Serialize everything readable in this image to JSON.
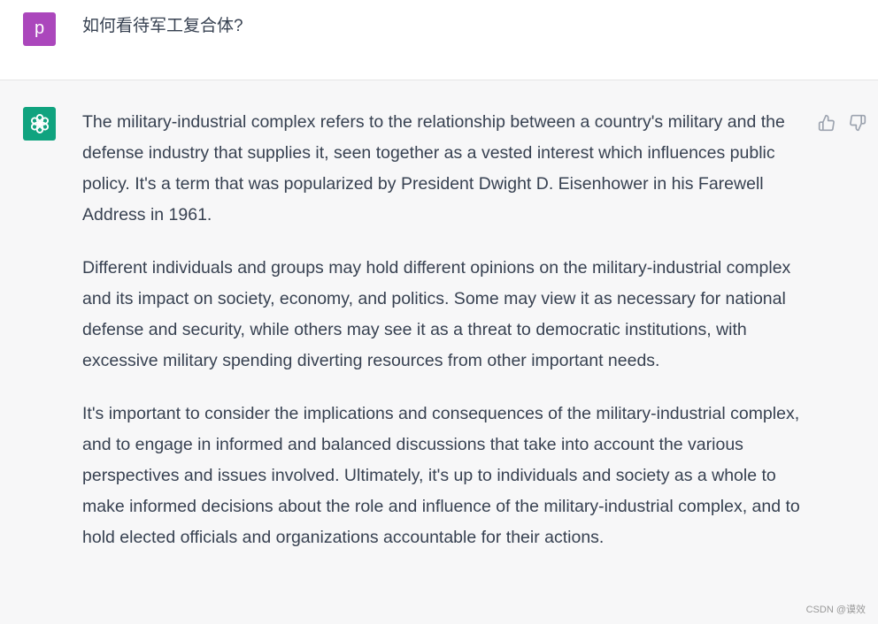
{
  "user": {
    "avatar_letter": "p",
    "avatar_color": "#ab47bc",
    "question": "如何看待军工复合体?"
  },
  "assistant": {
    "avatar_icon": "openai-logo-icon",
    "avatar_color": "#10a37f",
    "paragraphs": [
      "The military-industrial complex refers to the relationship between a country's military and the defense industry that supplies it, seen together as a vested interest which influences public policy. It's a term that was popularized by President Dwight D. Eisenhower in his Farewell Address in 1961.",
      "Different individuals and groups may hold different opinions on the military-industrial complex and its impact on society, economy, and politics. Some may view it as necessary for national defense and security, while others may see it as a threat to democratic institutions, with excessive military spending diverting resources from other important needs.",
      "It's important to consider the implications and consequences of the military-industrial complex, and to engage in informed and balanced discussions that take into account the various perspectives and issues involved. Ultimately, it's up to individuals and society as a whole to make informed decisions about the role and influence of the military-industrial complex, and to hold elected officials and organizations accountable for their actions."
    ],
    "feedback_icons": [
      "thumbs-up-icon",
      "thumbs-down-icon"
    ]
  },
  "watermark": "CSDN @谟效"
}
